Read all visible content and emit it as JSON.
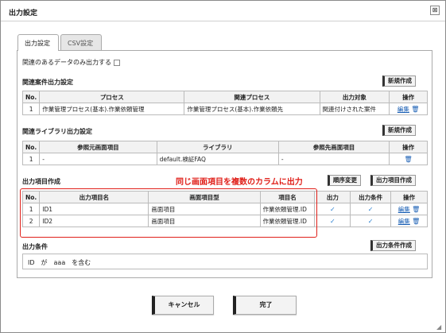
{
  "dialog": {
    "title": "出力設定",
    "close_symbol": "⊠"
  },
  "tabs": [
    {
      "label": "出力設定"
    },
    {
      "label": "CSV設定"
    }
  ],
  "related_only": {
    "label": "関連のあるデータのみ出力する"
  },
  "case_output": {
    "heading": "関連案件出力設定",
    "new_button": "新規作成",
    "columns": [
      "No.",
      "プロセス",
      "関連プロセス",
      "出力対象",
      "操作"
    ],
    "rows": [
      {
        "no": "1",
        "process": "作業管理プロセス(基本).作業依頼管理",
        "related": "作業管理プロセス(基本).作業依頼先",
        "target": "関連付けされた案件",
        "edit": "編集"
      }
    ]
  },
  "library_output": {
    "heading": "関連ライブラリ出力設定",
    "new_button": "新規作成",
    "columns": [
      "No.",
      "参照元画面項目",
      "ライブラリ",
      "参照先画面項目",
      "操作"
    ],
    "rows": [
      {
        "no": "1",
        "source": "-",
        "library": "default.検証FAQ",
        "dest": "-"
      }
    ]
  },
  "output_items": {
    "heading": "出力項目作成",
    "annotation": "同じ画面項目を複数のカラムに出力",
    "order_button": "順序変更",
    "create_button": "出力項目作成",
    "columns": [
      "No.",
      "出力項目名",
      "画面項目型",
      "項目名",
      "出力",
      "出力条件",
      "操作"
    ],
    "rows": [
      {
        "no": "1",
        "name": "ID1",
        "type": "画面項目",
        "item": "作業依頼管理.ID",
        "edit": "編集"
      },
      {
        "no": "2",
        "name": "ID2",
        "type": "画面項目",
        "item": "作業依頼管理.ID",
        "edit": "編集"
      }
    ]
  },
  "output_condition": {
    "heading": "出力条件",
    "create_button": "出力条件作成",
    "value": "ID　が　aaa　を含む"
  },
  "footer": {
    "cancel": "キャンセル",
    "ok": "完了"
  },
  "colors": {
    "accent_red": "#e0201a",
    "link_blue": "#1a5fb4"
  }
}
